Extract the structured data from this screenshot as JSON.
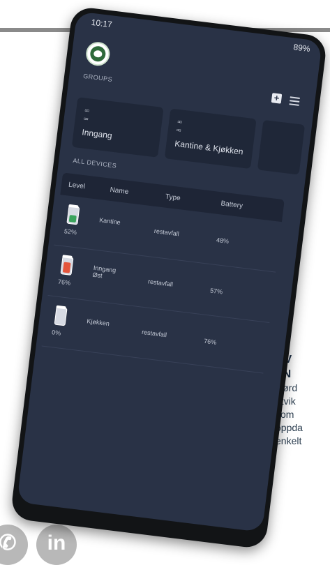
{
  "status_bar": {
    "time": "10:17",
    "battery": "89%"
  },
  "groups_label": "GROUPS",
  "groups": [
    {
      "name": "Inngang"
    },
    {
      "name": "Kantine & Kjøkken"
    }
  ],
  "devices_label": "ALL DEVICES",
  "table": {
    "headers": {
      "level": "Level",
      "name": "Name",
      "type": "Type",
      "battery": "Battery"
    },
    "rows": [
      {
        "level": "52%",
        "fill_percent": 52,
        "fill_color": "#3aa35c",
        "name": "Kantine",
        "type": "restavfall",
        "battery": "48%"
      },
      {
        "level": "76%",
        "fill_percent": 76,
        "fill_color": "#e4553c",
        "name": "Inngang Øst",
        "type": "restavfall",
        "battery": "57%"
      },
      {
        "level": "0%",
        "fill_percent": 0,
        "fill_color": "#3aa35c",
        "name": "Kjøkken",
        "type": "restavfall",
        "battery": "76%"
      }
    ]
  },
  "side_text": {
    "heading_1": "OV",
    "heading_2": "EN",
    "lines": [
      "Rørd",
      "utvik",
      "som",
      "oppda",
      "enkelt"
    ]
  },
  "social": {
    "rss": "✆",
    "linkedin": "in"
  }
}
